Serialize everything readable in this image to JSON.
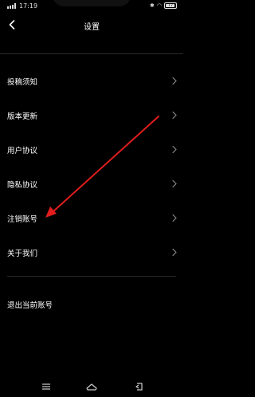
{
  "status_bar": {
    "time": "17:19",
    "battery": "77",
    "bluetooth_icon": "bluetooth-icon",
    "wifi_icon": "wifi-icon"
  },
  "header": {
    "title": "设置",
    "back_icon": "chevron-left-icon"
  },
  "settings": {
    "items": [
      {
        "label": "投稿须知"
      },
      {
        "label": "版本更新"
      },
      {
        "label": "用户协议"
      },
      {
        "label": "隐私协议"
      },
      {
        "label": "注销账号"
      },
      {
        "label": "关于我们"
      }
    ],
    "logout_label": "退出当前账号"
  },
  "nav": {
    "menu_icon": "menu-icon",
    "home_icon": "home-icon",
    "back_icon": "back-icon"
  },
  "colors": {
    "background": "#000000",
    "annotation": "#e11d1d"
  }
}
